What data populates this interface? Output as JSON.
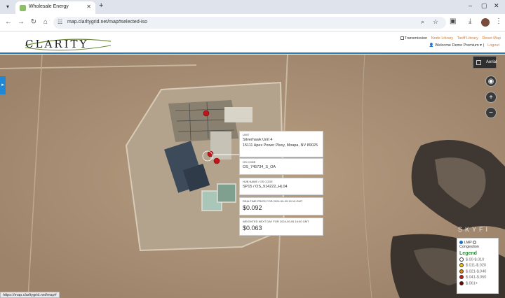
{
  "browser": {
    "tab_title": "Wholesale Energy",
    "url": "map.clarltygrid.net/map#selected-iso",
    "status_url": "https://map.clarltygrid.net/map#"
  },
  "header": {
    "logo_text": "CLARITY",
    "transmission_label": "Transmission",
    "node_library": "Node Library",
    "tariff_library": "Tariff Library",
    "reset_map": "Reset Map",
    "welcome": "Welcome Demo Premium",
    "logout": "Logout"
  },
  "map": {
    "aerial_label": "Aerial",
    "attribution": "SKYFI"
  },
  "popup": {
    "unit_label": "UNIT",
    "unit_name": "Silverhawk Unit 4",
    "unit_address": "15111 Apex Power Pkwy, Moapa, NV 89025",
    "os_code_label": "OS CODE",
    "os_code_value": "OS_745734_S_OA",
    "hub_label": "HUB NAME / OS CODE",
    "hub_value": "SP15 / OS_914222_HL04",
    "realtime_label": "REALTIME PRICE FOR 2024-09-05 15:10 GMT",
    "realtime_value": "$0.092",
    "weighted_label": "WEIGHTED NEXT DAY FOR 2024-09-05 16:00 GMT",
    "weighted_value": "$0.063"
  },
  "legend": {
    "lmp_label": "LMP",
    "congestion_label": "Congestion",
    "title": "Legend",
    "items": [
      {
        "label": "$.00-$.010",
        "color": "#ffffff"
      },
      {
        "label": "$.011-$.020",
        "color": "#f5c400"
      },
      {
        "label": "$.021-$.040",
        "color": "#e08a00"
      },
      {
        "label": "$.041-$.060",
        "color": "#cc1a1a"
      },
      {
        "label": "$.061+",
        "color": "#7a0000"
      }
    ]
  }
}
